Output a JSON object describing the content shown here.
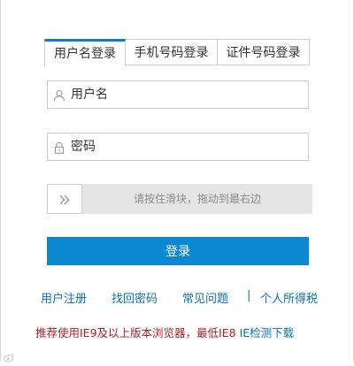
{
  "tabs": [
    {
      "label": "用户名登录",
      "active": true
    },
    {
      "label": "手机号码登录",
      "active": false
    },
    {
      "label": "证件号码登录",
      "active": false
    }
  ],
  "form": {
    "username_placeholder": "用户名",
    "username_value": "",
    "password_placeholder": "密码",
    "password_value": "",
    "slider_hint": "请按住滑块，拖动到最右边",
    "submit_label": "登录"
  },
  "links": {
    "register": "用户注册",
    "recover": "找回密码",
    "faq": "常见问题",
    "separator": "|",
    "tax": "个人所得税"
  },
  "notice": {
    "text": "推荐使用IE9及以上版本浏览器，最低IE8",
    "link": "IE检测下载"
  },
  "icons": {
    "username": "user-icon",
    "password": "lock-icon",
    "slider": "double-chevron-right-icon",
    "watermark": "weibo-icon"
  },
  "colors": {
    "accent": "#0b88d0",
    "link": "#0b6fb8",
    "notice_red": "#b01e23",
    "slider_track": "#e5e5e5"
  }
}
